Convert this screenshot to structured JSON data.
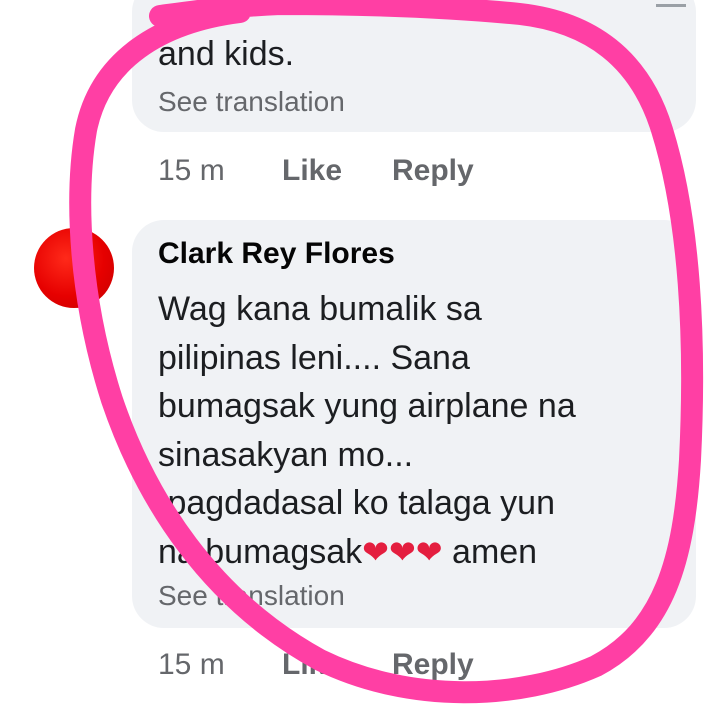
{
  "prev_comment": {
    "text": "and kids.",
    "see_translation": "See translation",
    "time": "15 m",
    "like": "Like",
    "reply": "Reply"
  },
  "comment": {
    "author": "Clark Rey Flores",
    "lines": [
      "Wag kana bumalik sa",
      "pilipinas leni.... Sana",
      "bumagsak yung airplane na",
      "sinasakyan mo...",
      "Ipagdadasal ko talaga yun"
    ],
    "last_line_start": "na bumagsak",
    "hearts": "❤❤❤",
    "last_line_end": "amen",
    "see_translation": "See translation",
    "time": "15 m",
    "like": "Like",
    "reply": "Reply"
  },
  "colors": {
    "annotation": "#ff3fa4",
    "bubble": "#f0f2f5",
    "avatar": "#e60000"
  }
}
